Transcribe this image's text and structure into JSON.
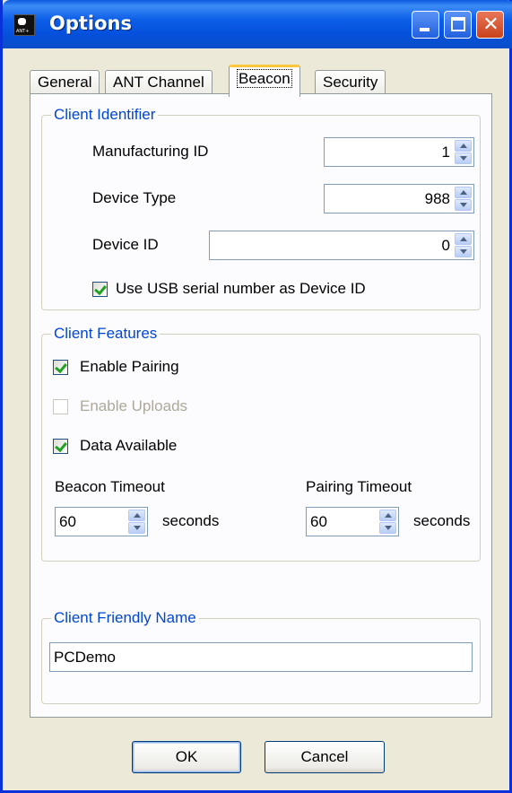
{
  "window": {
    "title": "Options",
    "icon_text": "ANT+",
    "icons": {
      "app": "ant-plus-app-icon",
      "minimize": "minimize-icon",
      "maximize": "maximize-icon",
      "close": "close-icon"
    },
    "close_glyph": "✕"
  },
  "tabs": [
    {
      "label": "General"
    },
    {
      "label": "ANT Channel"
    },
    {
      "label": "Beacon",
      "active": true
    },
    {
      "label": "Security"
    }
  ],
  "client_identifier": {
    "legend": "Client Identifier",
    "manufacturing_id": {
      "label": "Manufacturing ID",
      "value": "1"
    },
    "device_type": {
      "label": "Device Type",
      "value": "988"
    },
    "device_id": {
      "label": "Device ID",
      "value": "0"
    },
    "use_usb_serial": {
      "label": "Use USB serial number as Device ID",
      "checked": true
    }
  },
  "client_features": {
    "legend": "Client Features",
    "enable_pairing": {
      "label": "Enable Pairing",
      "checked": true
    },
    "enable_uploads": {
      "label": "Enable Uploads",
      "checked": false,
      "disabled": true
    },
    "data_available": {
      "label": "Data Available",
      "checked": true
    },
    "beacon_timeout": {
      "label": "Beacon Timeout",
      "value": "60",
      "unit": "seconds"
    },
    "pairing_timeout": {
      "label": "Pairing Timeout",
      "value": "60",
      "unit": "seconds"
    }
  },
  "client_friendly_name": {
    "legend": "Client Friendly Name",
    "value": "PCDemo"
  },
  "buttons": {
    "ok": "OK",
    "cancel": "Cancel"
  },
  "colors": {
    "title_bar": "#0a5ae0",
    "group_legend": "#0046d5",
    "active_tab_accent": "#ffc83c",
    "dialog_bg": "#ece9d8"
  }
}
